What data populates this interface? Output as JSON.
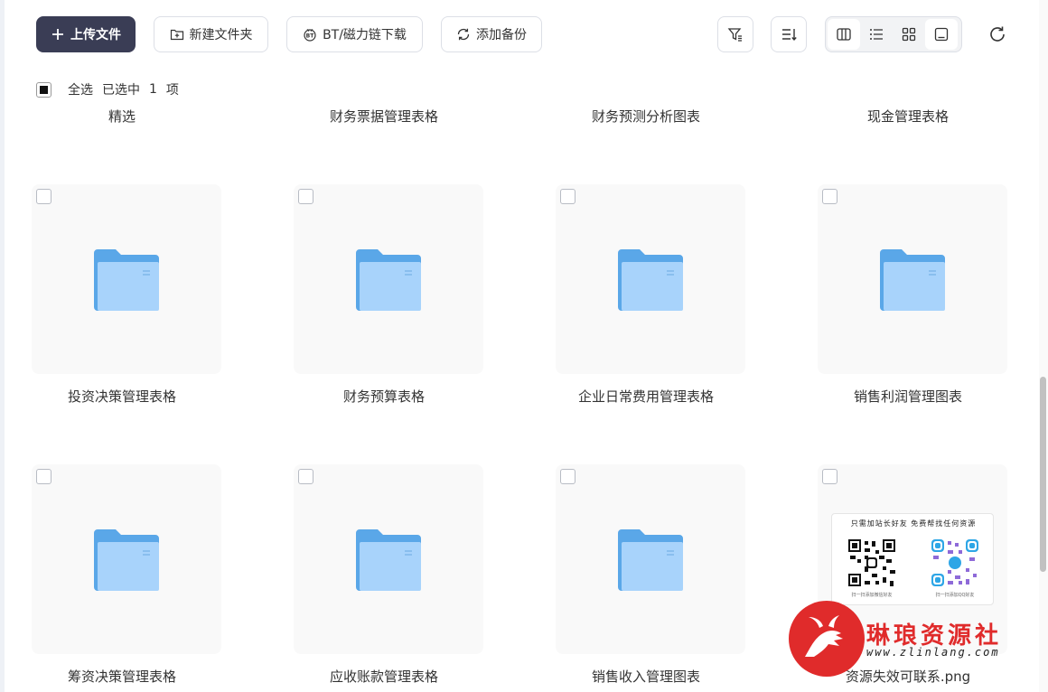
{
  "toolbar": {
    "upload_label": "上传文件",
    "new_folder_label": "新建文件夹",
    "bt_label": "BT/磁力链下载",
    "backup_label": "添加备份"
  },
  "selection": {
    "select_all_label": "全选",
    "selected_prefix": "已选中",
    "selected_count": "1",
    "selected_suffix": "项"
  },
  "top_row_labels": [
    "精选",
    "财务票据管理表格",
    "财务预测分析图表",
    "现金管理表格"
  ],
  "items": [
    {
      "name": "投资决策管理表格",
      "type": "folder"
    },
    {
      "name": "财务预算表格",
      "type": "folder"
    },
    {
      "name": "企业日常费用管理表格",
      "type": "folder"
    },
    {
      "name": "销售利润管理图表",
      "type": "folder"
    },
    {
      "name": "筹资决策管理表格",
      "type": "folder"
    },
    {
      "name": "应收账款管理表格",
      "type": "folder"
    },
    {
      "name": "销售收入管理图表",
      "type": "folder"
    },
    {
      "name": "资源失效可联系.png",
      "type": "image"
    }
  ],
  "qr_image": {
    "title": "只需加站长好友 免费帮找任何资源",
    "left_caption": "扫一扫添加微信好友",
    "right_caption": "扫一扫添加QQ好友"
  },
  "watermark": {
    "title": "琳琅资源社",
    "url": "www.zlinlang.com"
  },
  "colors": {
    "primary_button": "#3a3d55",
    "folder_blue": "#7cb9f0",
    "watermark_red": "#e02b2b"
  }
}
